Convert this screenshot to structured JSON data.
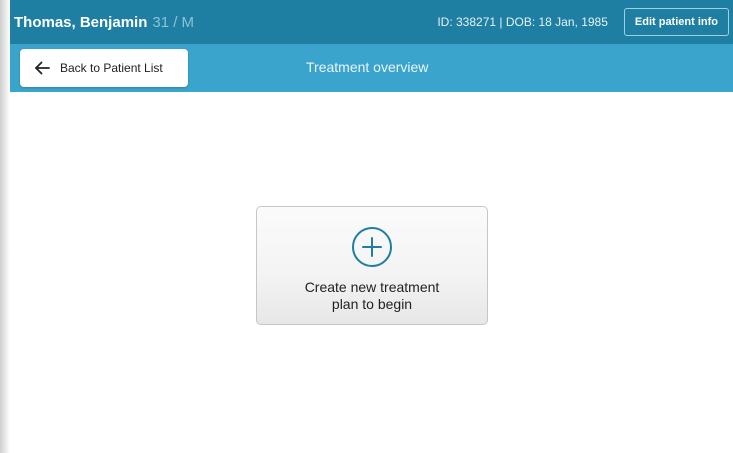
{
  "header": {
    "patient_name": "Thomas, Benjamin",
    "patient_age_sex": "31 / M",
    "patient_ids": "ID: 338271 | DOB: 18 Jan, 1985",
    "edit_label": "Edit patient info"
  },
  "subheader": {
    "back_label": "Back to Patient List",
    "back_icon": "arrow-left-icon",
    "title": "Treatment overview"
  },
  "main": {
    "create_icon": "plus-circle-icon",
    "create_line1": "Create new treatment",
    "create_line2": "plan to begin"
  },
  "colors": {
    "top_bar": "#1e7fa3",
    "sub_bar": "#3aa4cc",
    "accent": "#1e7fa3"
  }
}
